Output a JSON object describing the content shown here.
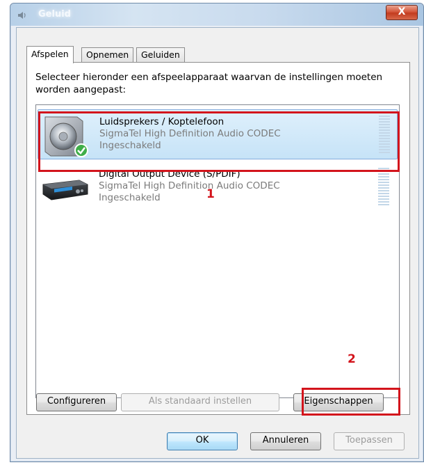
{
  "window": {
    "title": "Geluid",
    "close_glyph": "X"
  },
  "tabs": [
    {
      "label": "Afspelen",
      "active": true
    },
    {
      "label": "Opnemen",
      "active": false
    },
    {
      "label": "Geluiden",
      "active": false
    }
  ],
  "instruction": "Selecteer hieronder een afspeelapparaat waarvan de instellingen moeten worden aangepast:",
  "devices": [
    {
      "name": "Luidsprekers / Koptelefoon",
      "driver": "SigmaTel High Definition Audio CODEC",
      "status": "Ingeschakeld",
      "icon": "speaker-icon",
      "selected": true,
      "default": true
    },
    {
      "name": "Digital Output Device (S/PDIF)",
      "driver": "SigmaTel High Definition Audio CODEC",
      "status": "Ingeschakeld",
      "icon": "digital-output-device-icon",
      "selected": false,
      "default": false
    }
  ],
  "annotations": {
    "callout_1": "1",
    "callout_2": "2",
    "highlight_color": "#d3141c"
  },
  "buttons": {
    "configure": "Configureren",
    "set_default": "Als standaard instellen",
    "properties": "Eigenschappen",
    "ok": "OK",
    "cancel": "Annuleren",
    "apply": "Toepassen"
  }
}
